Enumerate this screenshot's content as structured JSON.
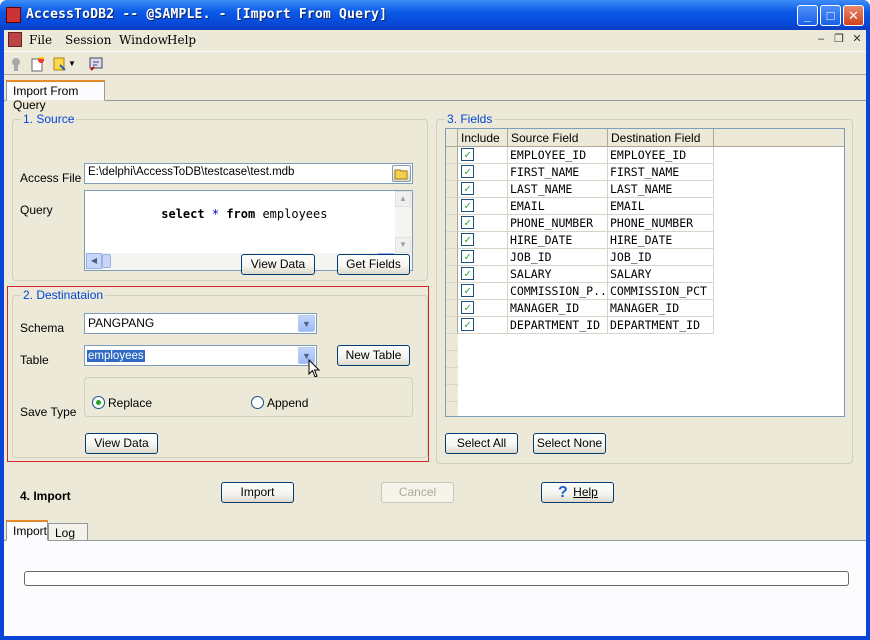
{
  "window": {
    "title": "AccessToDB2 -- @SAMPLE. - [Import From Query]",
    "min": "_",
    "max": "□",
    "close": "✕"
  },
  "menu": {
    "file": "File",
    "session": "Session",
    "window": "Window",
    "help": "Help",
    "mdi_min": "–",
    "mdi_restore": "❐",
    "mdi_close": "✕"
  },
  "tabs": {
    "main": "Import From Query",
    "import": "Import",
    "log": "Log"
  },
  "source": {
    "title": "1. Source",
    "access_label": "Access File",
    "access_value": "E:\\delphi\\AccessToDB\\testcase\\test.mdb",
    "query_label": "Query",
    "query_kw1": "select",
    "query_star": "*",
    "query_kw2": "from",
    "query_table": "employees",
    "view_data": "View Data",
    "get_fields": "Get Fields"
  },
  "dest": {
    "title": "2. Destinataion",
    "schema_label": "Schema",
    "schema_value": "PANGPANG",
    "table_label": "Table",
    "table_value": "employees",
    "new_table": "New Table",
    "save_label": "Save Type",
    "replace": "Replace",
    "append": "Append",
    "view_data": "View Data"
  },
  "fields": {
    "title": "3. Fields",
    "col_include": "Include",
    "col_source": "Source Field",
    "col_dest": "Destination Field",
    "rows": [
      {
        "src": "EMPLOYEE_ID",
        "dst": "EMPLOYEE_ID"
      },
      {
        "src": "FIRST_NAME",
        "dst": "FIRST_NAME"
      },
      {
        "src": "LAST_NAME",
        "dst": "LAST_NAME"
      },
      {
        "src": "EMAIL",
        "dst": "EMAIL"
      },
      {
        "src": "PHONE_NUMBER",
        "dst": "PHONE_NUMBER"
      },
      {
        "src": "HIRE_DATE",
        "dst": "HIRE_DATE"
      },
      {
        "src": "JOB_ID",
        "dst": "JOB_ID"
      },
      {
        "src": "SALARY",
        "dst": "SALARY"
      },
      {
        "src": "COMMISSION_P...",
        "dst": "COMMISSION_PCT"
      },
      {
        "src": "MANAGER_ID",
        "dst": "MANAGER_ID"
      },
      {
        "src": "DEPARTMENT_ID",
        "dst": "DEPARTMENT_ID"
      }
    ],
    "select_all": "Select All",
    "select_none": "Select None"
  },
  "import": {
    "label": "4. Import",
    "import_btn": "Import",
    "cancel_btn": "Cancel",
    "help_btn": "Help",
    "help_icon": "?"
  },
  "colors": {
    "title_blue": "#0a5ae8",
    "group_title": "#0046d5",
    "highlight": "#d42828",
    "check": "#21a121"
  }
}
